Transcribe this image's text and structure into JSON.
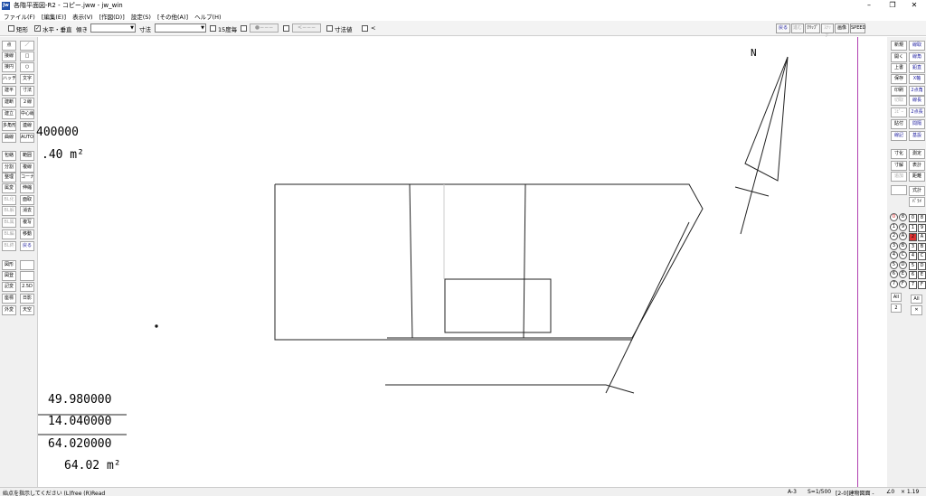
{
  "window": {
    "title": "各階平面図-R2 - コピー.jww - jw_win",
    "app_icon": "Jw",
    "minimize": "–",
    "maximize": "❐",
    "close": "✕"
  },
  "menu": [
    "ファイル(F)",
    "[編集(E)]",
    "表示(V)",
    "[作図(D)]",
    "設定(S)",
    "[その他(A)]",
    "ヘルプ(H)"
  ],
  "controlbar": {
    "rect_label": "矩形",
    "horiz_vert_label": "水平・垂直",
    "horiz_vert_checked": "✓",
    "slope_label": "傾き",
    "dim_label": "寸法",
    "deg15_label": "15度毎",
    "arrow_btn1": "●−−−",
    "arrow_btn2": "<−−−",
    "dimval_label": "寸法値",
    "lt_label": "<",
    "right_buttons": [
      "戻る",
      "進む",
      "ｸﾘｯﾌﾟ",
      "ｽﾅｯﾌﾟ",
      "画像",
      "SPEED"
    ]
  },
  "left_tools": [
    [
      "点",
      "／"
    ],
    [
      "接線",
      "□"
    ],
    [
      "接円",
      "○"
    ],
    [
      "ハッチ",
      "文字"
    ],
    [
      "建平",
      "寸法"
    ],
    [
      "建断",
      "２線"
    ],
    [
      "建立",
      "中心線"
    ],
    [
      "多角形",
      "連線"
    ],
    [
      "曲線",
      "AUTO"
    ],
    [
      "包絡",
      "範囲"
    ],
    [
      "分割",
      "複線"
    ],
    [
      "整理",
      "コーナー"
    ],
    [
      "属変",
      "伸縮"
    ],
    [
      "BL化",
      "面取"
    ],
    [
      "BL解",
      "消去"
    ],
    [
      "BL属",
      "複写"
    ],
    [
      "BL編",
      "移動"
    ],
    [
      "BL終",
      "戻る"
    ],
    [
      "図形",
      ""
    ],
    [
      "図登",
      ""
    ],
    [
      "記変",
      "2.5D"
    ],
    [
      "座標",
      "日影"
    ],
    [
      "外変",
      "天空"
    ]
  ],
  "right_tools": [
    [
      "新規",
      "線取"
    ],
    [
      "開く",
      "線角"
    ],
    [
      "上書",
      "鉛直"
    ],
    [
      "保存",
      "X軸"
    ],
    [
      "印刷",
      "2点角"
    ],
    [
      "切取",
      "線長"
    ],
    [
      "ｺﾋﾟｰ",
      "2点長"
    ],
    [
      "貼付",
      "間隔"
    ],
    [
      "線記",
      "基設"
    ],
    [
      "寸化",
      "測定"
    ],
    [
      "寸解",
      "表計"
    ],
    [
      "追加",
      "距離"
    ],
    [
      "",
      "式計"
    ],
    [
      "",
      "ﾊﾟﾗﾒ"
    ]
  ],
  "layers": {
    "circle": [
      "0",
      "8",
      "1",
      "9",
      "2",
      "A",
      "3",
      "B",
      "4",
      "C",
      "5",
      "D",
      "6",
      "E",
      "7",
      "F"
    ],
    "group": [
      "0",
      "8",
      "1",
      "9",
      "2",
      "A",
      "3",
      "B",
      "4",
      "C",
      "5",
      "D",
      "6",
      "E",
      "7",
      "F"
    ],
    "all_left": "All",
    "all_right": "All",
    "scale_left": "2",
    "cross": "✕"
  },
  "canvas": {
    "north_label": "N",
    "num_top1": "400000",
    "num_top2": ".40 m²",
    "num_b1": "49.980000",
    "num_b2": "14.040000",
    "num_b3": "64.020000",
    "num_b4": "64.02 m²"
  },
  "status": {
    "message": "始点を指示してください (L)free (R)Read",
    "paper": "A-3",
    "scale": "S=1/500",
    "layer": "[2-0]建物図面 -",
    "angle": "∠0",
    "zoom": "× 1.19"
  }
}
